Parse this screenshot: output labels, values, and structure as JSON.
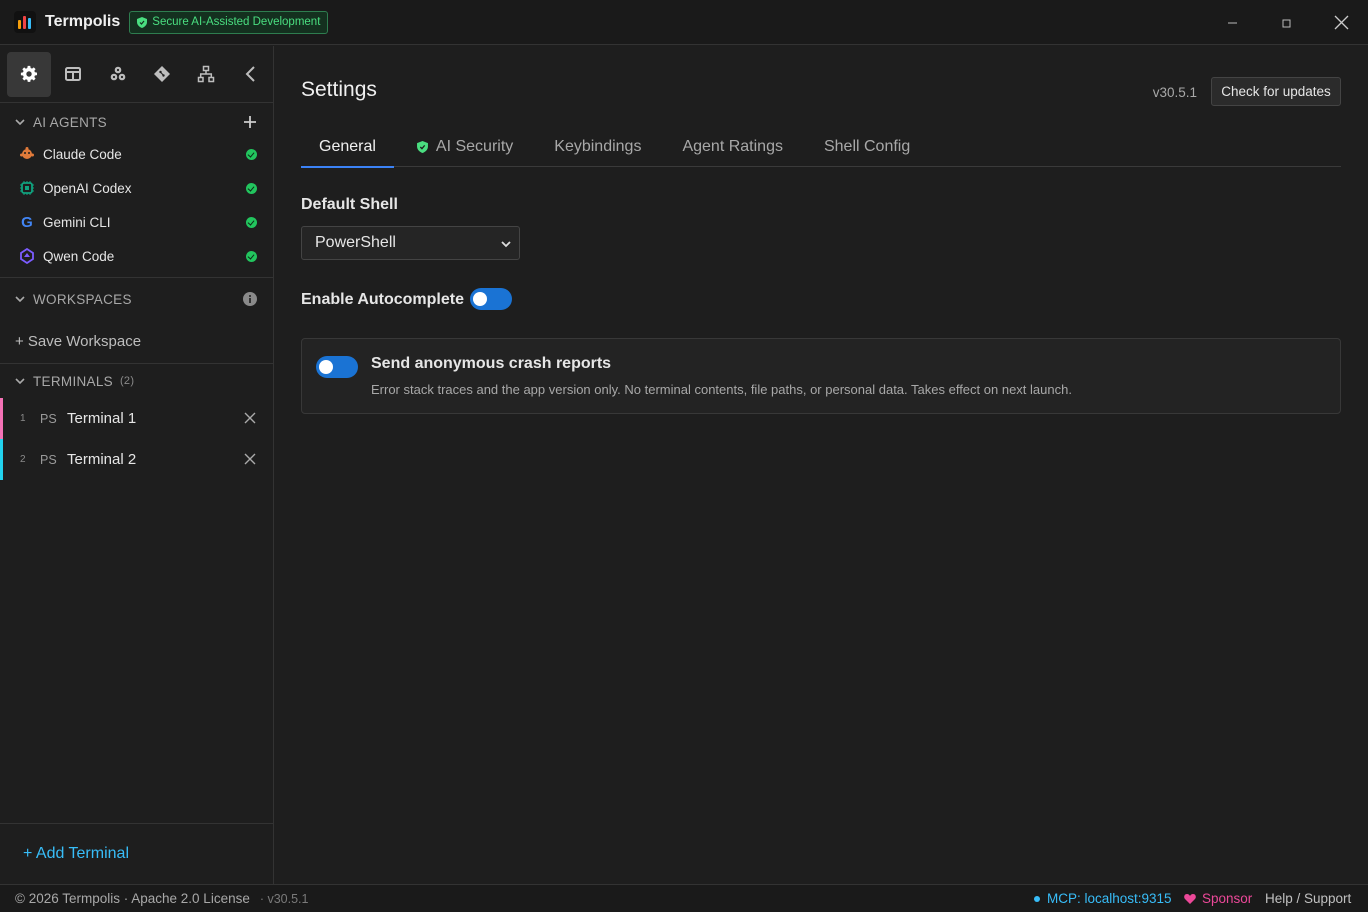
{
  "app": {
    "title": "Termpolis",
    "badge": "Secure AI-Assisted Development"
  },
  "window_controls": {
    "minimize": "–",
    "maximize": "□",
    "close": "✕"
  },
  "sidebar": {
    "toolbar_icons": [
      "gear-icon",
      "layout-icon",
      "agents-icon",
      "git-icon",
      "network-icon",
      "chevron-left-icon"
    ],
    "ai_agents": {
      "header": "AI AGENTS",
      "agents": [
        {
          "label": "Claude Code",
          "icon": "claude-icon",
          "color": "#e07a3a",
          "status": "online"
        },
        {
          "label": "OpenAI Codex",
          "icon": "openai-icon",
          "color": "#10a37f",
          "status": "online"
        },
        {
          "label": "Gemini CLI",
          "icon": "google-icon",
          "color": "#4285f4",
          "status": "online"
        },
        {
          "label": "Qwen Code",
          "icon": "qwen-icon",
          "color": "#7c5cff",
          "status": "online"
        }
      ]
    },
    "workspaces": {
      "header": "WORKSPACES",
      "save_label": "+ Save Workspace"
    },
    "terminals": {
      "header": "TERMINALS",
      "count": "(2)",
      "items": [
        {
          "num": "1",
          "shell": "PS",
          "name": "Terminal 1",
          "accent": "#f472b6"
        },
        {
          "num": "2",
          "shell": "PS",
          "name": "Terminal 2",
          "accent": "#22d3ee"
        }
      ]
    },
    "add_terminal": "+ Add Terminal"
  },
  "settings": {
    "title": "Settings",
    "version": "v30.5.1",
    "check_updates": "Check for updates",
    "tabs": [
      "General",
      "AI Security",
      "Keybindings",
      "Agent Ratings",
      "Shell Config"
    ],
    "active_tab": "General",
    "default_shell_label": "Default Shell",
    "default_shell_value": "PowerShell",
    "autocomplete_label": "Enable Autocomplete",
    "autocomplete_enabled": true,
    "crash_reports": {
      "title": "Send anonymous crash reports",
      "description": "Error stack traces and the app version only. No terminal contents, file paths, or personal data. Takes effect on next launch.",
      "enabled": true
    }
  },
  "statusbar": {
    "copyright": "© 2026 Termpolis · Apache 2.0 License",
    "version": "· v30.5.1",
    "mcp": "MCP: localhost:9315",
    "sponsor": "Sponsor",
    "help": "Help / Support"
  },
  "colors": {
    "accent_blue": "#3b82f6",
    "toggle_blue": "#1a73d4",
    "success_green": "#22c55e",
    "link_cyan": "#38bdf8",
    "sponsor_pink": "#ec4899"
  }
}
